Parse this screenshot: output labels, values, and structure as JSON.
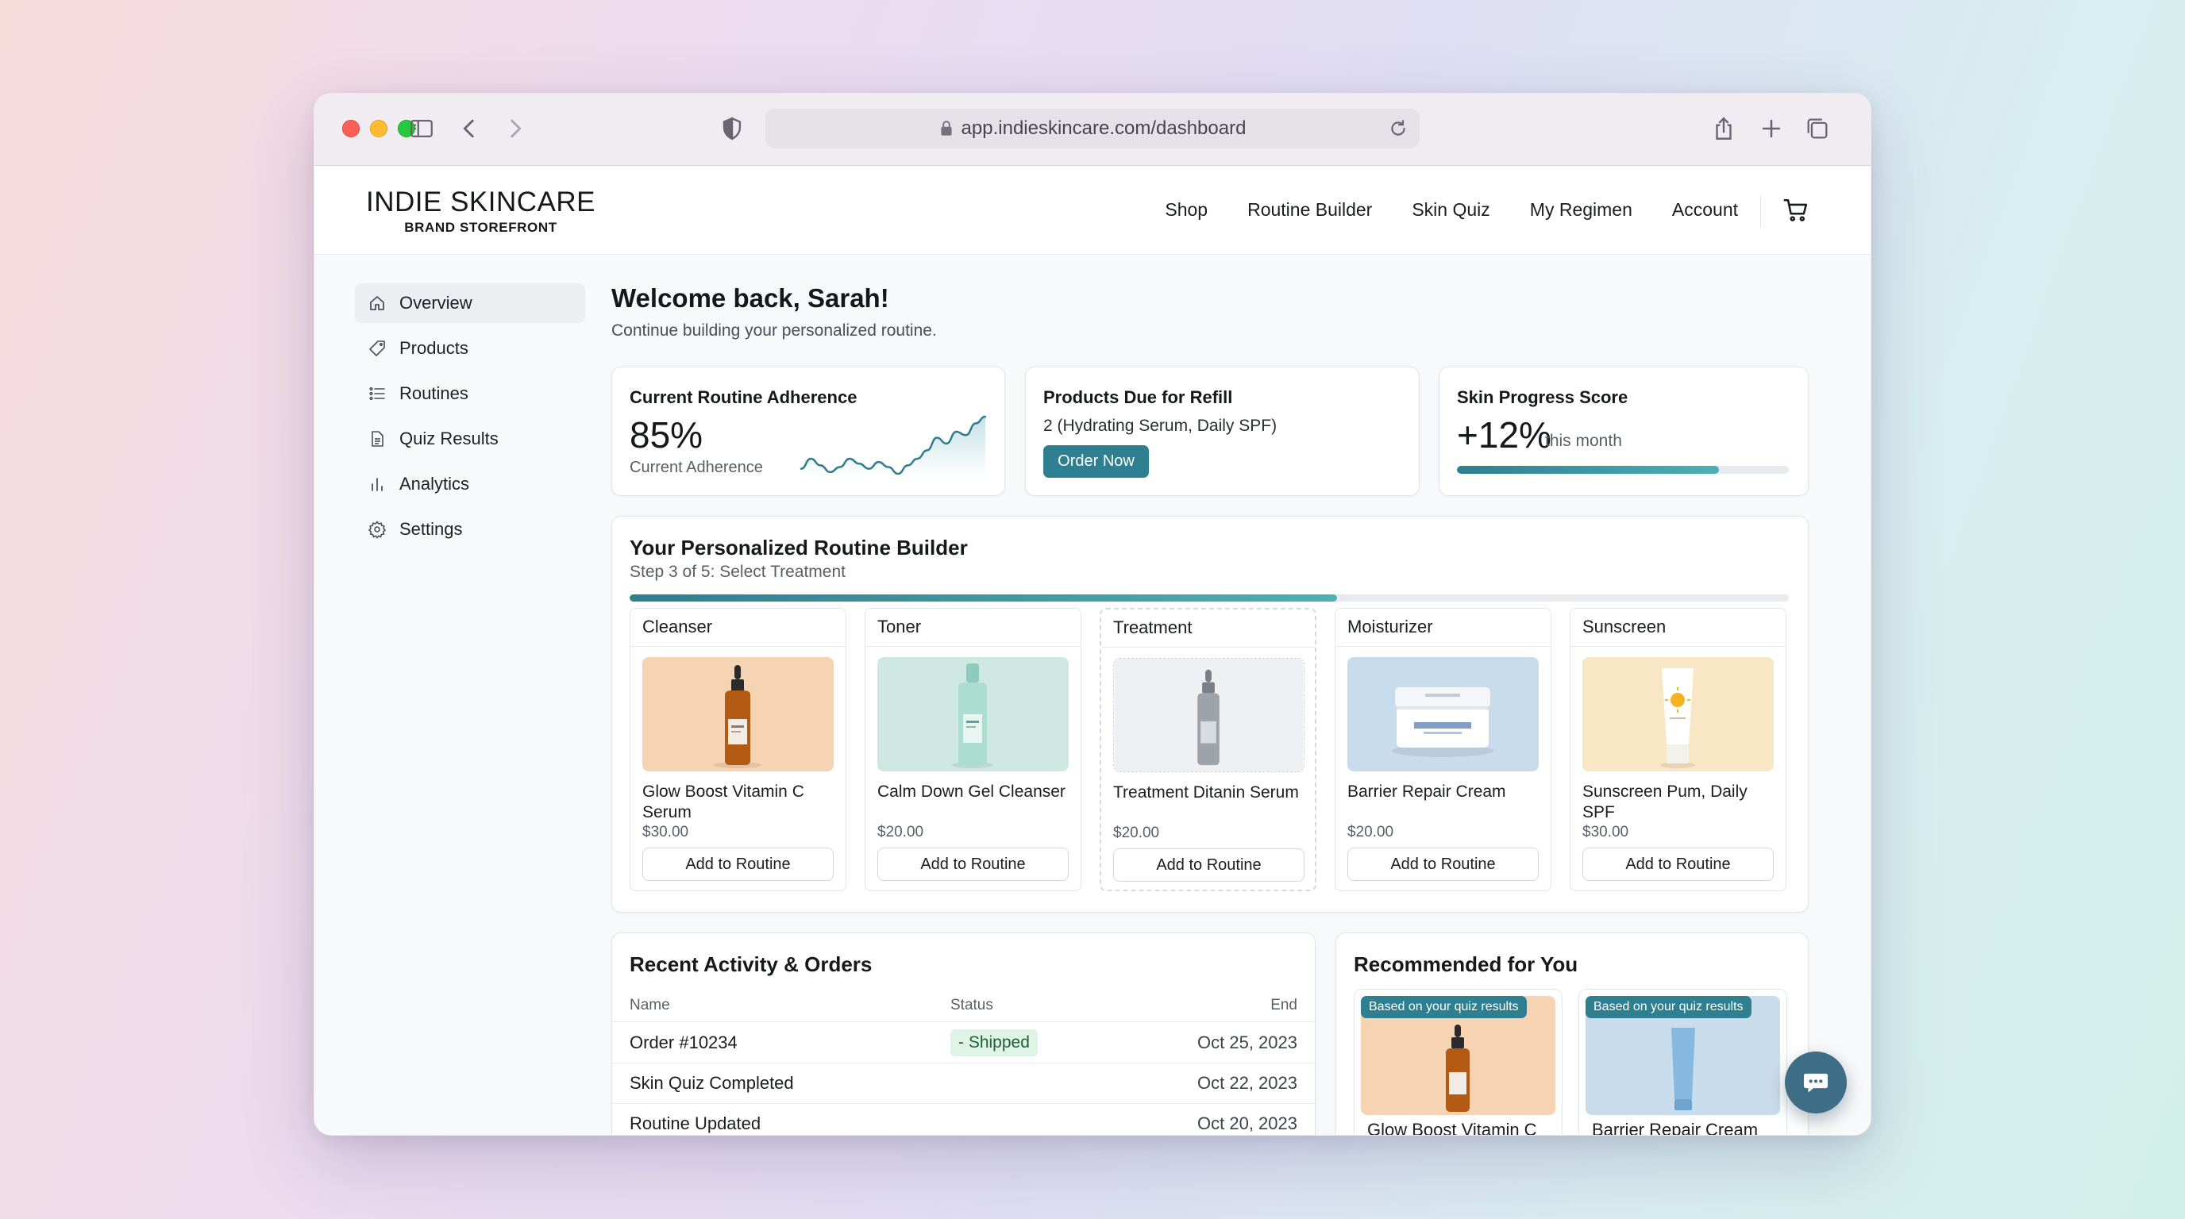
{
  "browser": {
    "url": "app.indieskincare.com/dashboard"
  },
  "brand": {
    "name": "INDIE SKINCARE",
    "subtitle": "BRAND STOREFRONT"
  },
  "topnav": {
    "items": [
      "Shop",
      "Routine Builder",
      "Skin Quiz",
      "My Regimen",
      "Account"
    ]
  },
  "sidebar": {
    "items": [
      {
        "label": "Overview",
        "icon": "home-icon",
        "active": true
      },
      {
        "label": "Products",
        "icon": "tag-icon"
      },
      {
        "label": "Routines",
        "icon": "list-icon"
      },
      {
        "label": "Quiz Results",
        "icon": "document-icon"
      },
      {
        "label": "Analytics",
        "icon": "bar-chart-icon"
      },
      {
        "label": "Settings",
        "icon": "gear-icon"
      }
    ]
  },
  "welcome": {
    "title": "Welcome back, Sarah!",
    "subtitle": "Continue building your personalized routine."
  },
  "stats": {
    "adherence": {
      "title": "Current Routine Adherence",
      "value": "85%",
      "caption": "Current Adherence",
      "sparkline": [
        18,
        30,
        22,
        14,
        20,
        30,
        24,
        18,
        26,
        20,
        12,
        22,
        30,
        40,
        55,
        48,
        62,
        58,
        72,
        80
      ]
    },
    "refill": {
      "title": "Products Due for Refill",
      "detail": "2 (Hydrating Serum, Daily SPF)",
      "button": "Order Now"
    },
    "progress": {
      "title": "Skin Progress Score",
      "value": "+12%",
      "caption": "this month",
      "fill_fraction": 0.79
    }
  },
  "builder": {
    "title": "Your Personalized Routine Builder",
    "step_text": "Step 3 of 5: Select Treatment",
    "progress_fraction": 0.61,
    "steps": [
      {
        "category": "Cleanser",
        "product": "Glow Boost Vitamin C Serum",
        "price": "$30.00",
        "button": "Add to Routine"
      },
      {
        "category": "Toner",
        "product": "Calm Down Gel Cleanser",
        "price": "$20.00",
        "button": "Add to Routine"
      },
      {
        "category": "Treatment",
        "product": "Treatment Ditanin Serum",
        "price": "$20.00",
        "button": "Add to Routine"
      },
      {
        "category": "Moisturizer",
        "product": "Barrier Repair Cream",
        "price": "$20.00",
        "button": "Add to Routine"
      },
      {
        "category": "Sunscreen",
        "product": "Sunscreen Pum, Daily SPF",
        "price": "$30.00",
        "button": "Add to Routine"
      }
    ]
  },
  "activity": {
    "title": "Recent Activity & Orders",
    "columns": [
      "Name",
      "Status",
      "End"
    ],
    "rows": [
      {
        "name": "Order #10234",
        "status": "- Shipped",
        "date": "Oct 25, 2023"
      },
      {
        "name": "Skin Quiz Completed",
        "status": "",
        "date": "Oct 22, 2023"
      },
      {
        "name": "Routine Updated",
        "status": "",
        "date": "Oct 20, 2023"
      }
    ]
  },
  "recommended": {
    "title": "Recommended for You",
    "items": [
      {
        "badge": "Based on your quiz results",
        "name": "Glow Boost Vitamin C"
      },
      {
        "badge": "Based on your quiz results",
        "name": "Barrier Repair Cream"
      }
    ]
  },
  "colors": {
    "accent": "#2e7f90",
    "status_green_bg": "#dff3e6",
    "cleanser_bg": "#f6d3b3",
    "toner_bg": "#cfe9e2",
    "treatment_bg": "#eef0f3",
    "moisturizer_bg": "#c9dcec",
    "sunscreen_bg": "#f8e6c5"
  }
}
